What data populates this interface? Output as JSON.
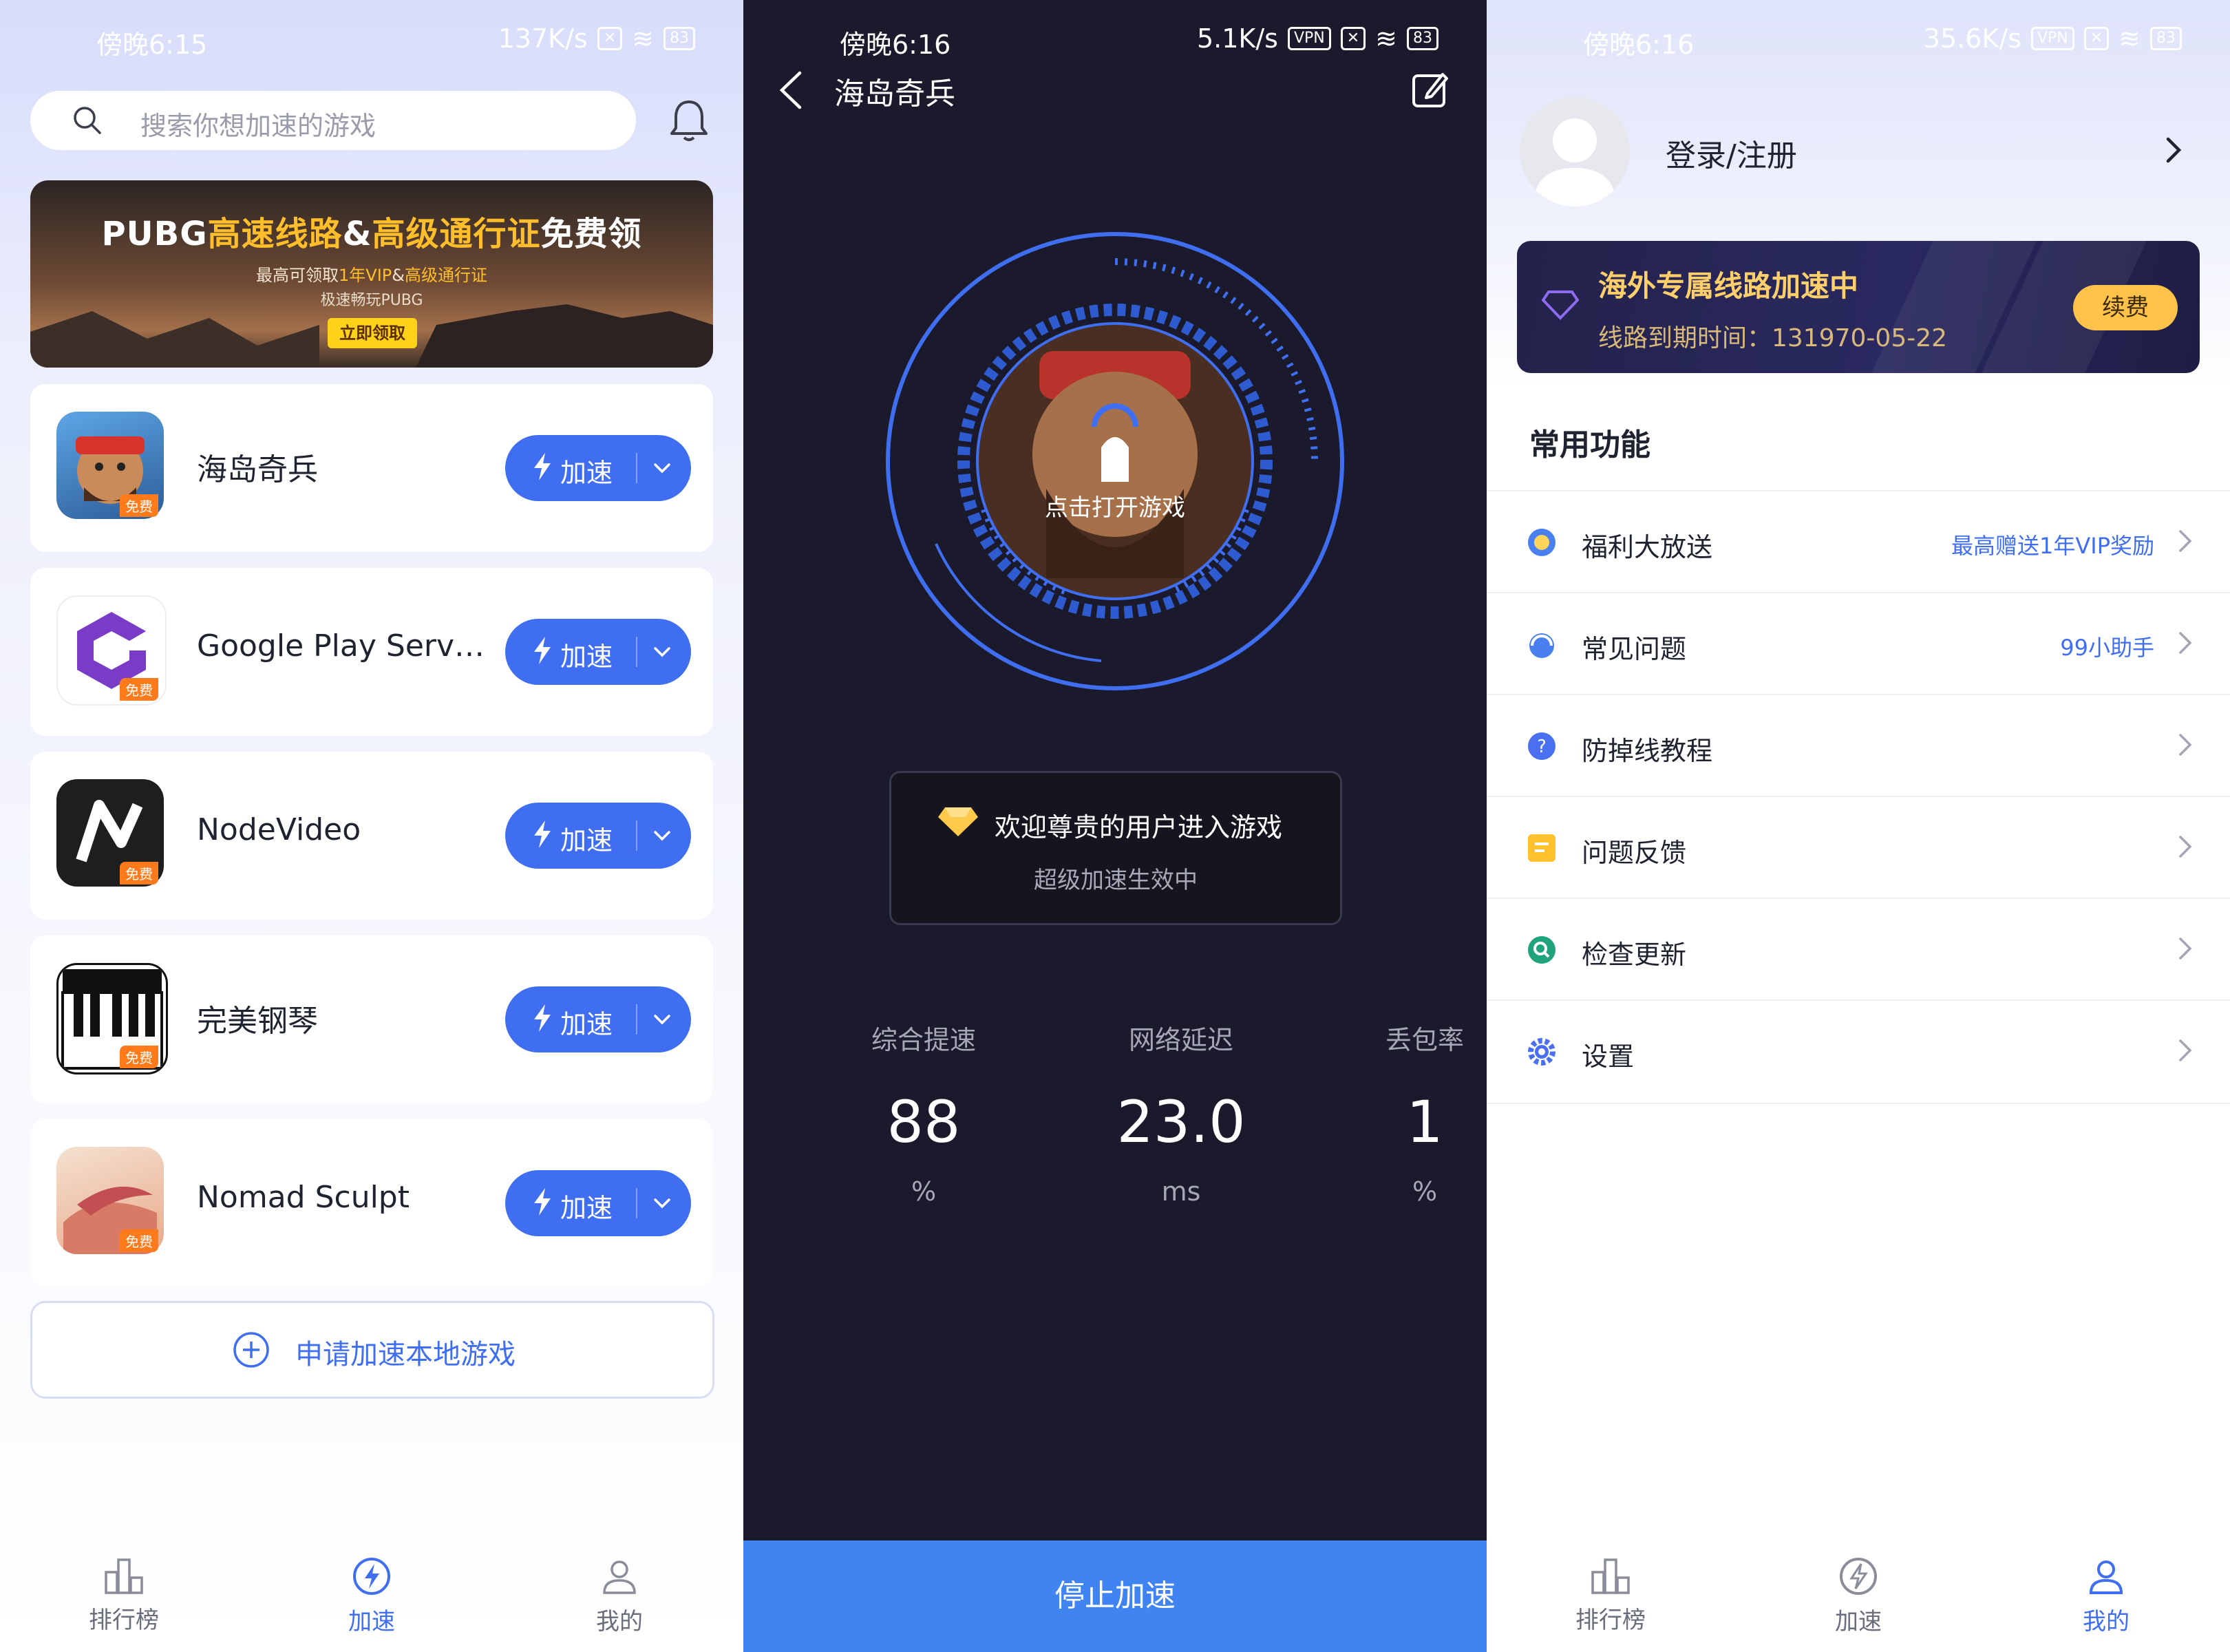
{
  "colors": {
    "accent": "#3f6ff0",
    "dark_bg": "#1b1a2c",
    "gold": "#ffcf6b",
    "free_badge": "#ff7a1a"
  },
  "home": {
    "status": {
      "time": "傍晚6:15",
      "speed": "137K/s",
      "battery": "83"
    },
    "search": {
      "placeholder": "搜索你想加速的游戏",
      "icon": "search-icon"
    },
    "bell_icon": "bell-icon",
    "banner": {
      "title_white_1": "PUBG",
      "title_yellow_1": "高速线路",
      "title_white_2": "&",
      "title_yellow_2": "高级通行证",
      "title_white_3": "免费领",
      "line2_a": "最高可领取",
      "line2_b": "1年VIP",
      "line2_c": "&",
      "line2_d": "高级通行证",
      "line3": "极速畅玩PUBG",
      "cta": "立即领取"
    },
    "games": [
      {
        "name": "海岛奇兵",
        "badge": "免费",
        "button": "加速"
      },
      {
        "name": "Google Play Servi…",
        "badge": "免费",
        "button": "加速"
      },
      {
        "name": "NodeVideo",
        "badge": "免费",
        "button": "加速"
      },
      {
        "name": "完美钢琴",
        "badge": "免费",
        "button": "加速"
      },
      {
        "name": "Nomad Sculpt",
        "badge": "免费",
        "button": "加速"
      }
    ],
    "local_button": "申请加速本地游戏",
    "tabs": [
      {
        "label": "排行榜",
        "icon": "ranking-icon"
      },
      {
        "label": "加速",
        "icon": "boost-icon"
      },
      {
        "label": "我的",
        "icon": "profile-icon"
      }
    ],
    "active_tab": "加速"
  },
  "boost": {
    "status": {
      "time": "傍晚6:16",
      "speed": "5.1K/s",
      "battery": "83"
    },
    "title": "海岛奇兵",
    "radar_caption": "点击打开游戏",
    "welcome_title": "欢迎尊贵的用户进入游戏",
    "welcome_sub": "超级加速生效中",
    "stats": [
      {
        "label": "综合提速",
        "value": "88",
        "unit": "%"
      },
      {
        "label": "网络延迟",
        "value": "23.0",
        "unit": "ms"
      },
      {
        "label": "丢包率",
        "value": "1",
        "unit": "%"
      }
    ],
    "stop_button": "停止加速"
  },
  "profile": {
    "status": {
      "time": "傍晚6:16",
      "speed": "35.6K/s",
      "battery": "83"
    },
    "login": "登录/注册",
    "vip_title": "海外专属线路加速中",
    "vip_expiry": "线路到期时间：131970-05-22",
    "renew": "续费",
    "section": "常用功能",
    "menu": [
      {
        "label": "福利大放送",
        "right": "最高赠送1年VIP奖励",
        "icon": "gift-icon"
      },
      {
        "label": "常见问题",
        "right": "99小助手",
        "icon": "headset-icon"
      },
      {
        "label": "防掉线教程",
        "right": "",
        "icon": "help-icon"
      },
      {
        "label": "问题反馈",
        "right": "",
        "icon": "feedback-icon"
      },
      {
        "label": "检查更新",
        "right": "",
        "icon": "update-icon"
      },
      {
        "label": "设置",
        "right": "",
        "icon": "settings-icon"
      }
    ],
    "tabs": [
      {
        "label": "排行榜",
        "icon": "ranking-icon"
      },
      {
        "label": "加速",
        "icon": "boost-icon"
      },
      {
        "label": "我的",
        "icon": "profile-icon"
      }
    ],
    "active_tab": "我的"
  }
}
